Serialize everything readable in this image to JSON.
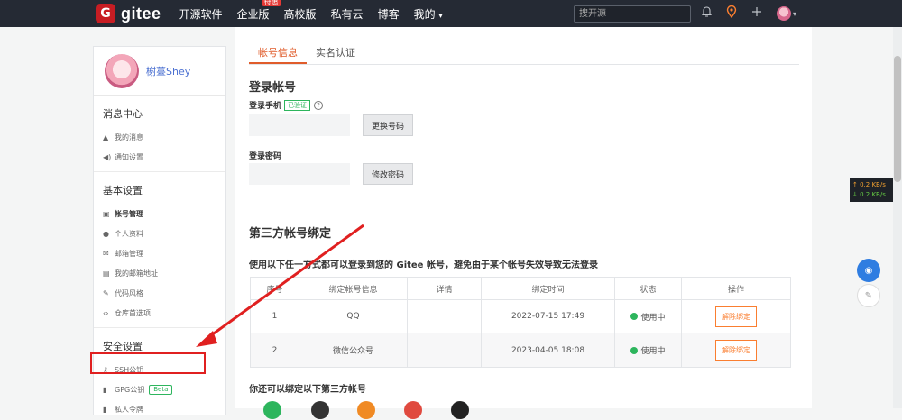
{
  "topbar": {
    "logo_mark": "G",
    "logo_text": "gitee",
    "nav": [
      "开源软件",
      "企业版",
      "高校版",
      "私有云",
      "博客",
      "我的"
    ],
    "enterprise_badge": "特惠",
    "my_caret": "▾",
    "search_placeholder": "搜开源"
  },
  "sidebar": {
    "user_name": "榭薹Shey",
    "message_center": "消息中心",
    "message_items": [
      "我的消息",
      "通知设置"
    ],
    "basic_settings": "基本设置",
    "basic_items": [
      "帐号管理",
      "个人资料",
      "邮箱管理",
      "我的邮箱地址",
      "代码风格",
      "仓库首选项"
    ],
    "security_settings": "安全设置",
    "security_items": [
      "SSH公钥",
      "GPG公钥",
      "私人令牌"
    ],
    "gpg_badge": "Beta"
  },
  "tabs": [
    "帐号信息",
    "实名认证"
  ],
  "login": {
    "title": "登录帐号",
    "phone_label": "登录手机",
    "verified": "已验证",
    "help": "?",
    "change_phone": "更换号码",
    "password_label": "登录密码",
    "change_password": "修改密码"
  },
  "third_party": {
    "title": "第三方帐号绑定",
    "description": "使用以下任一方式都可以登录到您的 Gitee 帐号，避免由于某个帐号失效导致无法登录",
    "headers": [
      "序号",
      "绑定帐号信息",
      "详情",
      "绑定时间",
      "状态",
      "操作"
    ],
    "rows": [
      {
        "index": "1",
        "account": "QQ",
        "detail": "",
        "time": "2022-07-15 17:49",
        "status": "使用中",
        "action": "解除绑定"
      },
      {
        "index": "2",
        "account": "微信公众号",
        "detail": "",
        "time": "2023-04-05 18:08",
        "status": "使用中",
        "action": "解除绑定"
      }
    ],
    "more_title": "你还可以绑定以下第三方帐号"
  },
  "netspeed": {
    "up": "↑ 0.2 KB/s",
    "down": "↓ 0.2 KB/s"
  },
  "colors": {
    "accent": "#e05c2b",
    "topbar": "#252a34",
    "highlight": "#e02020",
    "success": "#2db55d"
  }
}
